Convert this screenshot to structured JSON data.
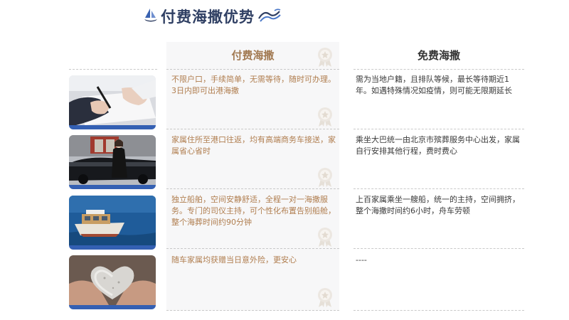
{
  "header": {
    "title": "付费海撒优势"
  },
  "columns": {
    "paid": "付费海撒",
    "free": "免费海撒"
  },
  "rows": [
    {
      "image": "signing-document-photo",
      "paid": "不限户口，手续简单，无需等待，随时可办理。3日内即可出港海撒",
      "free": "需为当地户籍，且排队等候，最长等待期近1年。如遇特殊情况如疫情，则可能无限期延长"
    },
    {
      "image": "business-car-escort-photo",
      "paid": "家属住所至港口往返，均有高端商务车接送，家属省心省时",
      "free": "乘坐大巴统一由北京市殡葬服务中心出发，家属自行安排其他行程，费时费心"
    },
    {
      "image": "private-boat-at-sea-photo",
      "paid": "独立船舶，空间安静舒适，全程一对一海撒服务。专门的司仪主持，可个性化布置告别船舱，整个海葬时间约90分钟",
      "free": "上百家属乘坐一艘船，统一的主持，空间拥挤，整个海撒时间约6小时，舟车劳顿"
    },
    {
      "image": "heart-stone-in-hands-photo",
      "paid": "随车家属均获赠当日意外险，更安心",
      "free": "----"
    }
  ],
  "colors": {
    "title": "#2f3f63",
    "paid_text": "#b07e4f",
    "paid_bg": "#f7f7f8",
    "thumb_accent": "#3460b3"
  },
  "icons": [
    "sailboat-icon",
    "wave-icon",
    "medal-icon"
  ]
}
